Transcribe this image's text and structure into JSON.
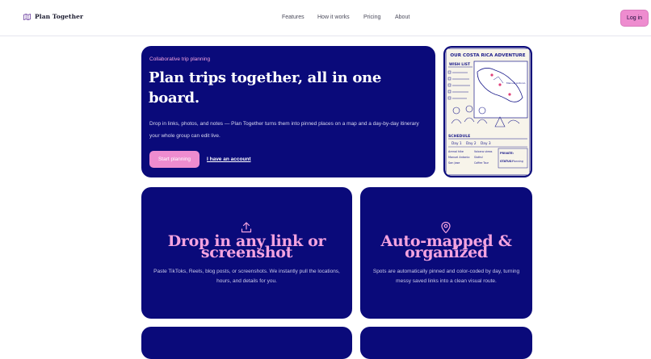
{
  "header": {
    "brand_name": "Plan Together",
    "nav": [
      {
        "label": "Features"
      },
      {
        "label": "How it works"
      },
      {
        "label": "Pricing"
      },
      {
        "label": "About"
      }
    ],
    "login_label": "Log in"
  },
  "hero": {
    "kicker": "Collaborative trip planning",
    "title": "Plan trips together, all in one board.",
    "description": "Drop in links, photos, and notes — Plan Together turns them into pinned places on a map and a day-by-day itinerary your whole group can edit live.",
    "primary_cta": "Start planning",
    "secondary_cta": "I have an account"
  },
  "poster": {
    "heading": "OUR COSTA RICA ADVENTURE",
    "wish_list_label": "WISH LIST",
    "schedule_label": "SCHEDULE",
    "days": [
      "Day 1",
      "Day 2",
      "Day 3"
    ],
    "places": [
      "Arenal hike",
      "Manuel Antonio",
      "San Jose"
    ],
    "activities": [
      "Volcano views",
      "Sloths!",
      "Coffee Tour"
    ],
    "private_label": "PRIVATE:",
    "status_label": "STATUS:",
    "status_value": "Planning"
  },
  "features": [
    {
      "icon": "upload-icon",
      "title": "Drop in any link or screenshot",
      "description": "Paste TikToks, Reels, blog posts, or screenshots. We instantly pull the locations, hours, and details for you."
    },
    {
      "icon": "map-pin-icon",
      "title": "Auto-mapped & organized",
      "description": "Spots are automatically pinned and color-coded by day, turning messy saved links into a clean visual route."
    }
  ],
  "colors": {
    "navy": "#0a0a7a",
    "pink": "#ee8ccf",
    "pink_text": "#f4a3df"
  }
}
